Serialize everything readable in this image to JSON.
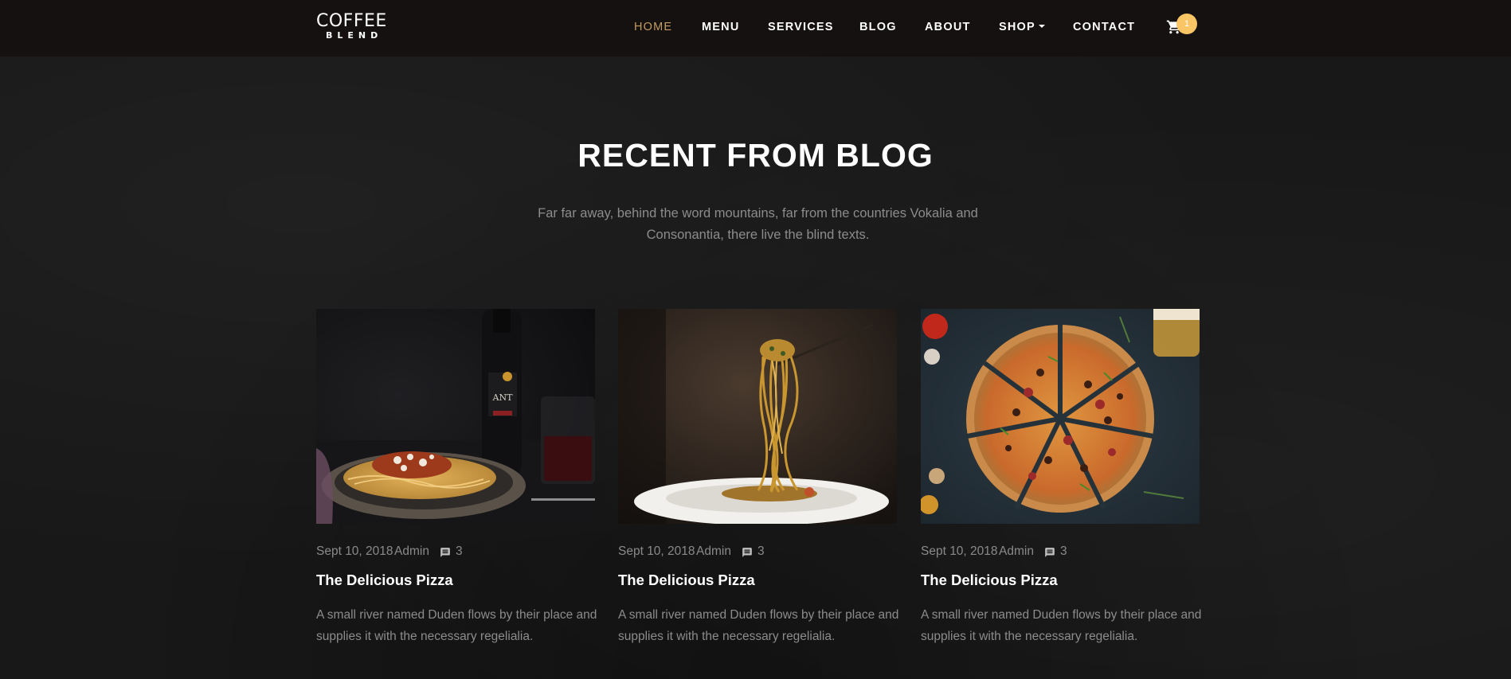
{
  "brand": {
    "line1": "COFFEE",
    "line2": "BLEND"
  },
  "nav": {
    "items": [
      {
        "label": "HOME",
        "active": true
      },
      {
        "label": "MENU"
      },
      {
        "label": "SERVICES"
      },
      {
        "label": "BLOG"
      },
      {
        "label": "ABOUT"
      },
      {
        "label": "SHOP",
        "has_dropdown": true
      },
      {
        "label": "CONTACT"
      }
    ],
    "cart_count": "1",
    "active_color": "#c49b63",
    "badge_color": "#fac564"
  },
  "section": {
    "title": "RECENT FROM BLOG",
    "subtitle": "Far far away, behind the word mountains, far from the countries Vokalia and Consonantia, there live the blind texts."
  },
  "posts": [
    {
      "image": "spaghetti-bolognese-with-wine",
      "date": "Sept 10, 2018",
      "author": "Admin",
      "comments": "3",
      "title": "The Delicious Pizza",
      "excerpt": "A small river named Duden flows by their place and supplies it with the necessary regelialia."
    },
    {
      "image": "pasta-on-fork",
      "date": "Sept 10, 2018",
      "author": "Admin",
      "comments": "3",
      "title": "The Delicious Pizza",
      "excerpt": "A small river named Duden flows by their place and supplies it with the necessary regelialia."
    },
    {
      "image": "sliced-pizza",
      "date": "Sept 10, 2018",
      "author": "Admin",
      "comments": "3",
      "title": "The Delicious Pizza",
      "excerpt": "A small river named Duden flows by their place and supplies it with the necessary regelialia."
    }
  ]
}
